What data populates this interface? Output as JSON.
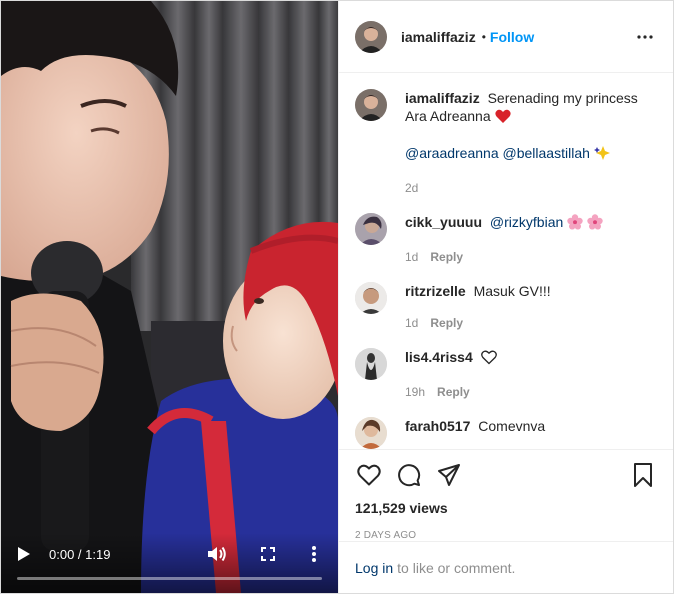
{
  "video": {
    "current_time": "0:00",
    "duration": "1:19",
    "time_separator": " / ",
    "progress": 0
  },
  "header": {
    "username": "iamaliffaziz",
    "separator": "•",
    "follow_label": "Follow"
  },
  "caption": {
    "username": "iamaliffaziz",
    "text": "Serenading my princess Ara Adreanna",
    "mention_1": "@araadreanna",
    "mention_2": "@bellaastillah",
    "age": "2d"
  },
  "comments": [
    {
      "username": "cikk_yuuuu",
      "mention": "@rizkyfbian",
      "text": "",
      "age": "1d",
      "reply_label": "Reply"
    },
    {
      "username": "ritzrizelle",
      "mention": "",
      "text": "Masuk GV!!!",
      "age": "1d",
      "reply_label": "Reply"
    },
    {
      "username": "lis4.4riss4",
      "mention": "",
      "text": "",
      "age": "19h",
      "reply_label": "Reply"
    },
    {
      "username": "farah0517",
      "mention": "",
      "text": "Comevnva",
      "age": "",
      "reply_label": ""
    }
  ],
  "stats": {
    "views": "121,529 views",
    "posted": "2 DAYS AGO"
  },
  "footer": {
    "login_label": "Log in",
    "login_suffix": "to like or comment."
  },
  "colors": {
    "link_blue": "#0095f6",
    "mention_blue": "#00376b",
    "heart_red": "#ed4956",
    "muted_gray": "#8e8e8e"
  },
  "icons": [
    "play-icon",
    "volume-icon",
    "fullscreen-icon",
    "more-vertical-icon",
    "more-horizontal-icon",
    "heart-icon",
    "comment-icon",
    "share-icon",
    "bookmark-icon"
  ]
}
